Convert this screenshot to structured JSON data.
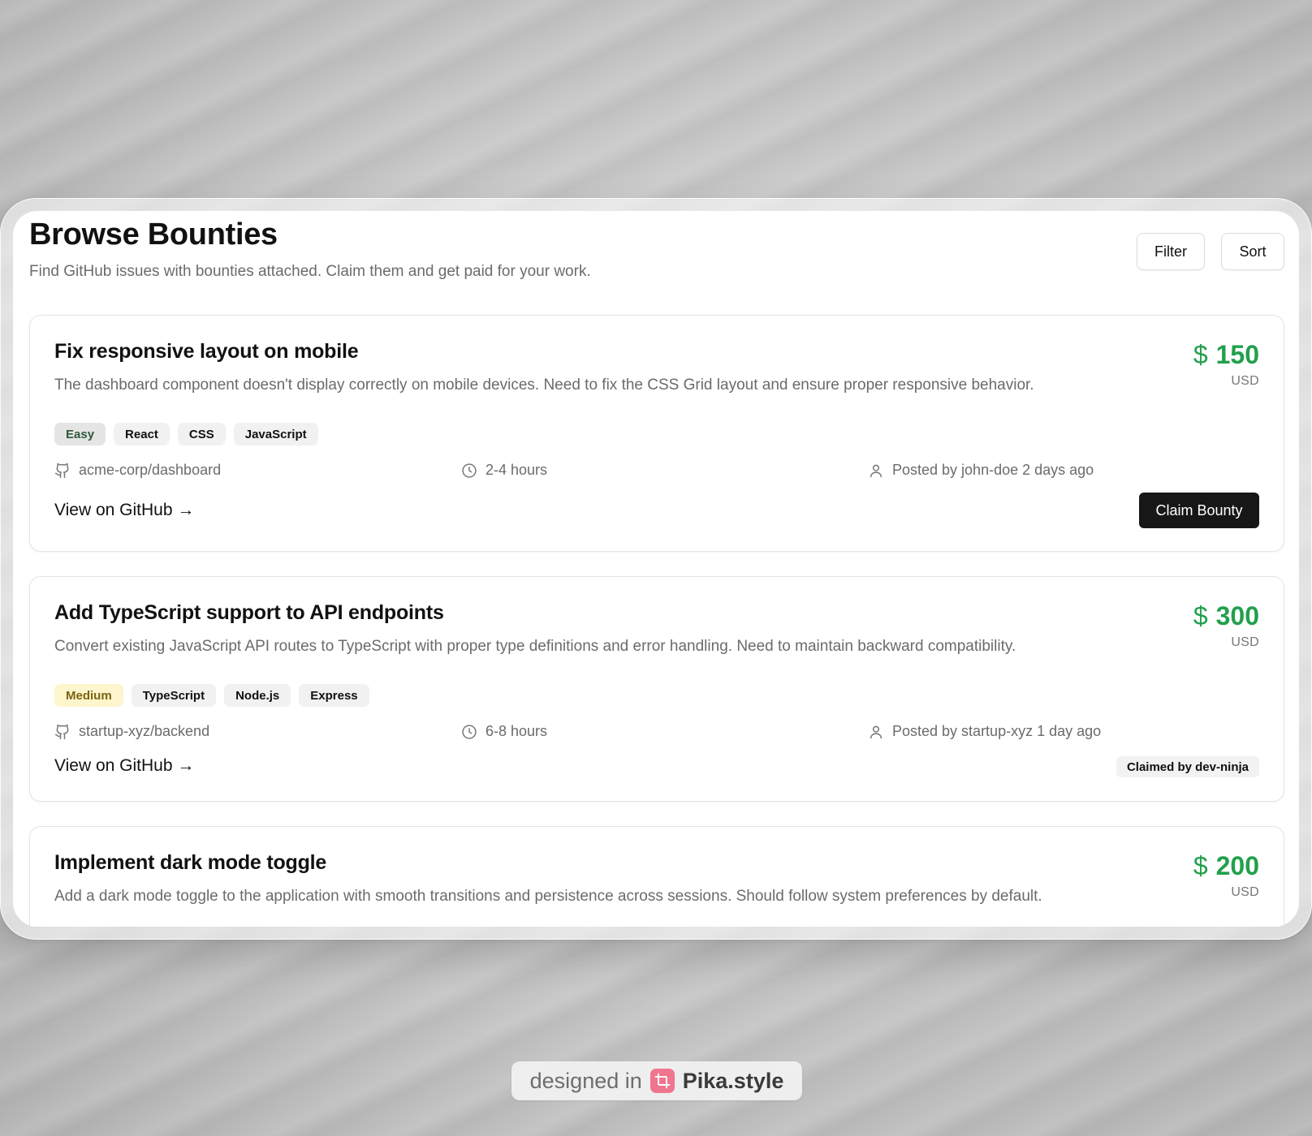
{
  "header": {
    "title": "Browse Bounties",
    "subtitle": "Find GitHub issues with bounties attached. Claim them and get paid for your work.",
    "filter_label": "Filter",
    "sort_label": "Sort"
  },
  "bounties": [
    {
      "title": "Fix responsive layout on mobile",
      "description": "The dashboard component doesn't display correctly on mobile devices. Need to fix the CSS Grid layout and ensure proper responsive behavior.",
      "currency_symbol": "$",
      "amount": "150",
      "currency": "USD",
      "difficulty": "Easy",
      "tags": [
        "React",
        "CSS",
        "JavaScript"
      ],
      "repo": "acme-corp/dashboard",
      "time_estimate": "2-4 hours",
      "posted": "Posted by john-doe 2 days ago",
      "link_label": "View on GitHub →",
      "action_label": "Claim Bounty"
    },
    {
      "title": "Add TypeScript support to API endpoints",
      "description": "Convert existing JavaScript API routes to TypeScript with proper type definitions and error handling. Need to maintain backward compatibility.",
      "currency_symbol": "$",
      "amount": "300",
      "currency": "USD",
      "difficulty": "Medium",
      "tags": [
        "TypeScript",
        "Node.js",
        "Express"
      ],
      "repo": "startup-xyz/backend",
      "time_estimate": "6-8 hours",
      "posted": "Posted by startup-xyz 1 day ago",
      "link_label": "View on GitHub →",
      "claimed_label": "Claimed by dev-ninja"
    },
    {
      "title": "Implement dark mode toggle",
      "description": "Add a dark mode toggle to the application with smooth transitions and persistence across sessions. Should follow system preferences by default.",
      "currency_symbol": "$",
      "amount": "200",
      "currency": "USD"
    }
  ],
  "icons": {
    "repo": "github-icon",
    "time": "clock-icon",
    "posted": "user-icon"
  },
  "colors": {
    "amount": "#22a04c",
    "primary_button": "#171717",
    "easy_tag": "#e4e5e4",
    "medium_tag": "#fdf6cc",
    "watermark_logo": "#f0758f"
  },
  "watermark": {
    "prefix": "designed in",
    "brand": "Pika.style"
  }
}
